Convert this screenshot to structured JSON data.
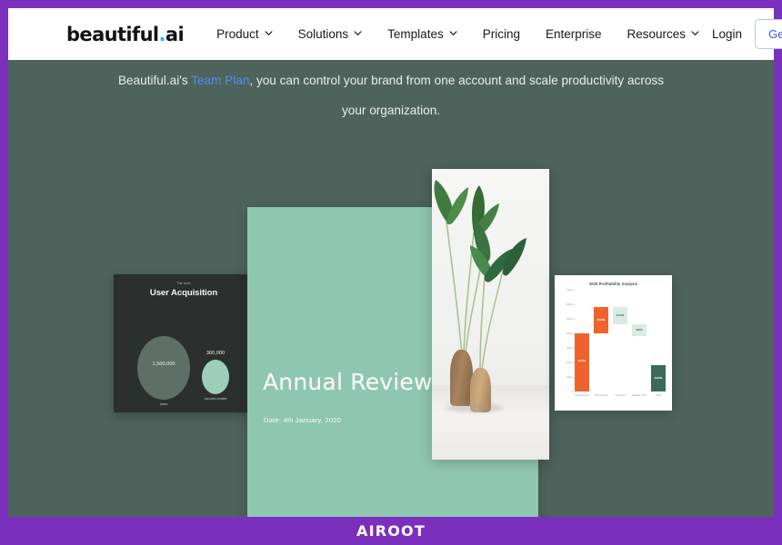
{
  "theme": {
    "frame_purple": "#7b30bd",
    "hero_bg": "#4d635c",
    "mint": "#8fc6b0",
    "dark_slide": "#2b2f2d",
    "accent_blue": "#3b53f0",
    "link_blue": "#5c87f5",
    "chart_orange": "#f0622c",
    "chart_mint": "#d8ece1",
    "chart_green": "#3c6a58"
  },
  "navbar": {
    "logo": {
      "main": "beautiful",
      "dot": ".",
      "suffix": "ai"
    },
    "links": [
      {
        "label": "Product",
        "has_caret": true,
        "icon": "chevron-down-icon"
      },
      {
        "label": "Solutions",
        "has_caret": true,
        "icon": "chevron-down-icon"
      },
      {
        "label": "Templates",
        "has_caret": true,
        "icon": "chevron-down-icon"
      },
      {
        "label": "Pricing",
        "has_caret": false,
        "icon": ""
      },
      {
        "label": "Enterprise",
        "has_caret": false,
        "icon": ""
      },
      {
        "label": "Resources",
        "has_caret": true,
        "icon": "chevron-down-icon"
      }
    ],
    "login_label": "Login",
    "cta_label": "Get Started"
  },
  "hero": {
    "text_before": "Beautiful.ai's ",
    "link_text": "Team Plan",
    "text_after": ", you can control your brand from one account and scale productivity across your organization."
  },
  "slides": {
    "dark": {
      "eyebrow": "The truth",
      "title": "User Acquisition",
      "bubbles": [
        {
          "value": "1,500,000",
          "caption": "Users"
        },
        {
          "value": "300,000",
          "caption": "Accounts created"
        }
      ]
    },
    "mint": {
      "title": "Annual Review",
      "date": "Date: 4th January, 2020"
    },
    "photo": {
      "alt": "two wooden vases with green plant leaves on a white table"
    }
  },
  "chart_data": {
    "type": "bar",
    "title": "2020 Profitability Analysis",
    "xlabel": "",
    "ylabel": "",
    "ylim": [
      0,
      700
    ],
    "grid": false,
    "legend": "none",
    "categories": [
      "Total Revenue",
      "Subscriptions",
      "Overhead",
      "Variable Costs",
      "Profit"
    ],
    "values": [
      400,
      180,
      120,
      80,
      180
    ],
    "bar_labels": [
      "$400k",
      "$180k",
      "$120k",
      "$80k",
      "$180k"
    ],
    "bar_colors": [
      "#f0622c",
      "#f0622c",
      "#d8ece1",
      "#d8ece1",
      "#3c6a58"
    ],
    "ytick_labels": [
      "0",
      "100k",
      "200k",
      "300k",
      "400k",
      "500k",
      "600k",
      "700k"
    ],
    "waterfall_bases": [
      0,
      400,
      460,
      380,
      0
    ]
  },
  "footer": {
    "label": "AIROOT"
  }
}
